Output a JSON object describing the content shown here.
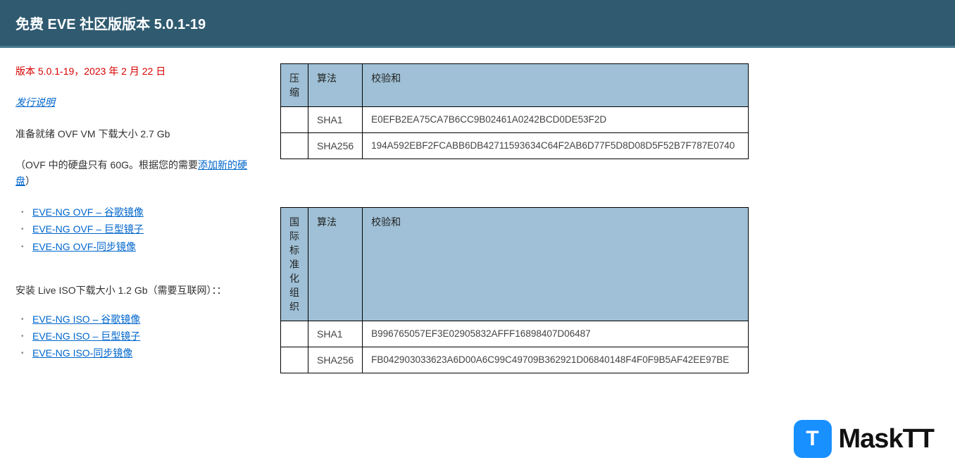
{
  "header": {
    "title": "免费 EVE 社区版版本 5.0.1-19"
  },
  "left": {
    "version_line": "版本 5.0.1-19，2023 年 2 月 22 日",
    "release_notes": "发行说明",
    "ready_line": "准备就绪 OVF VM 下载大小 2.7 Gb",
    "disk_note_before": "（OVF 中的硬盘只有 60G。根据您的需要",
    "disk_note_link": "添加新的硬盘",
    "disk_note_after": "）",
    "ovf_links": [
      "EVE-NG OVF – 谷歌镜像",
      "EVE-NG OVF – 巨型镜子 ",
      "EVE-NG OVF-同步镜像"
    ],
    "iso_line": "安装 Live ISO下载大小 1.2 Gb（需要互联网）：：",
    "iso_links": [
      "EVE-NG ISO – 谷歌镜像",
      "EVE-NG ISO – 巨型镜子",
      "EVE-NG ISO-同步镜像"
    ]
  },
  "tables": {
    "ovf": {
      "headers": {
        "c1": "压缩",
        "c2": "算法",
        "c3": "校验和"
      },
      "rows": [
        {
          "c1": "",
          "c2": "SHA1",
          "c3": "E0EFB2EA75CA7B6CC9B02461A0242BCD0DE53F2D"
        },
        {
          "c1": "",
          "c2": "SHA256",
          "c3": "194A592EBF2FCABB6DB42711593634C64F2AB6D77F5D8D08D5F52B7F787E0740"
        }
      ]
    },
    "iso": {
      "headers": {
        "c1": "国际标准化组织",
        "c2": "算法",
        "c3": "校验和"
      },
      "rows": [
        {
          "c1": "",
          "c2": "SHA1",
          "c3": "B996765057EF3E02905832AFFF16898407D06487"
        },
        {
          "c1": "",
          "c2": "SHA256",
          "c3": "FB042903033623A6D00A6C99C49709B362921D06840148F4F0F9B5AF42EE97BE"
        }
      ]
    }
  },
  "watermark": {
    "icon_letter": "T",
    "text": "MaskTT"
  }
}
